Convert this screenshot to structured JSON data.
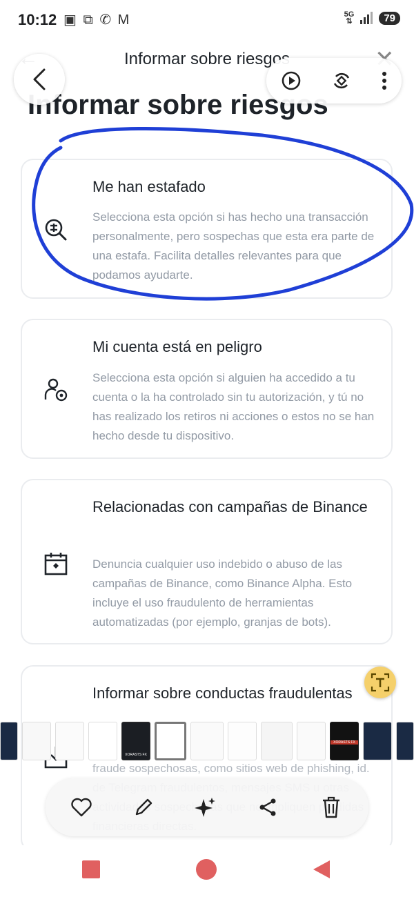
{
  "status_bar": {
    "time": "10:12",
    "notification_icons": [
      "calendar-icon",
      "screenshot-icon",
      "whatsapp-icon",
      "gmail-icon"
    ],
    "network": "5G",
    "battery": "79"
  },
  "header": {
    "title": "Informar sobre riesgos",
    "back_glyph": "←",
    "close_glyph": "✕"
  },
  "page_title": "Informar sobre riesgos",
  "cards": [
    {
      "icon": "scam-search-icon",
      "title": "Me han estafado",
      "description": "Selecciona esta opción si has hecho una transacción personalmente, pero sospechas que esta era parte de una estafa. Facilita detalles relevantes para que podamos ayudarte."
    },
    {
      "icon": "account-at-risk-icon",
      "title": "Mi cuenta está en peligro",
      "description": "Selecciona esta opción si alguien ha accedido a tu cuenta o la ha controlado sin tu autorización, y tú no has realizado los retiros ni acciones o estos no se han hecho desde tu dispositivo."
    },
    {
      "icon": "campaign-calendar-icon",
      "title": "Relacionadas con campañas de Binance",
      "description": "Denuncia cualquier uso indebido o abuso de las campañas de Binance, como Binance Alpha. Esto incluye el uso fraudulento de herramientas automatizadas (por ejemplo, granjas de bots)."
    },
    {
      "icon": "fraud-report-icon",
      "title": "Informar sobre conductas fraudulentas",
      "description": "fraude sospechosas, como sitios web de phishing, id. de Telegram fraudulentos, mensajes SMS u otras actividades sospechosas que no impliquen pérdidas financieras directas."
    }
  ],
  "thumbnail_labels": [
    "XORASTS FX",
    "XORASTS FX"
  ],
  "colors": {
    "ink": "#1f3fd6",
    "card_border": "#eaecef",
    "desc_text": "#929aa5",
    "accent_t": "#f5d06b",
    "nav_red": "#e06060"
  }
}
